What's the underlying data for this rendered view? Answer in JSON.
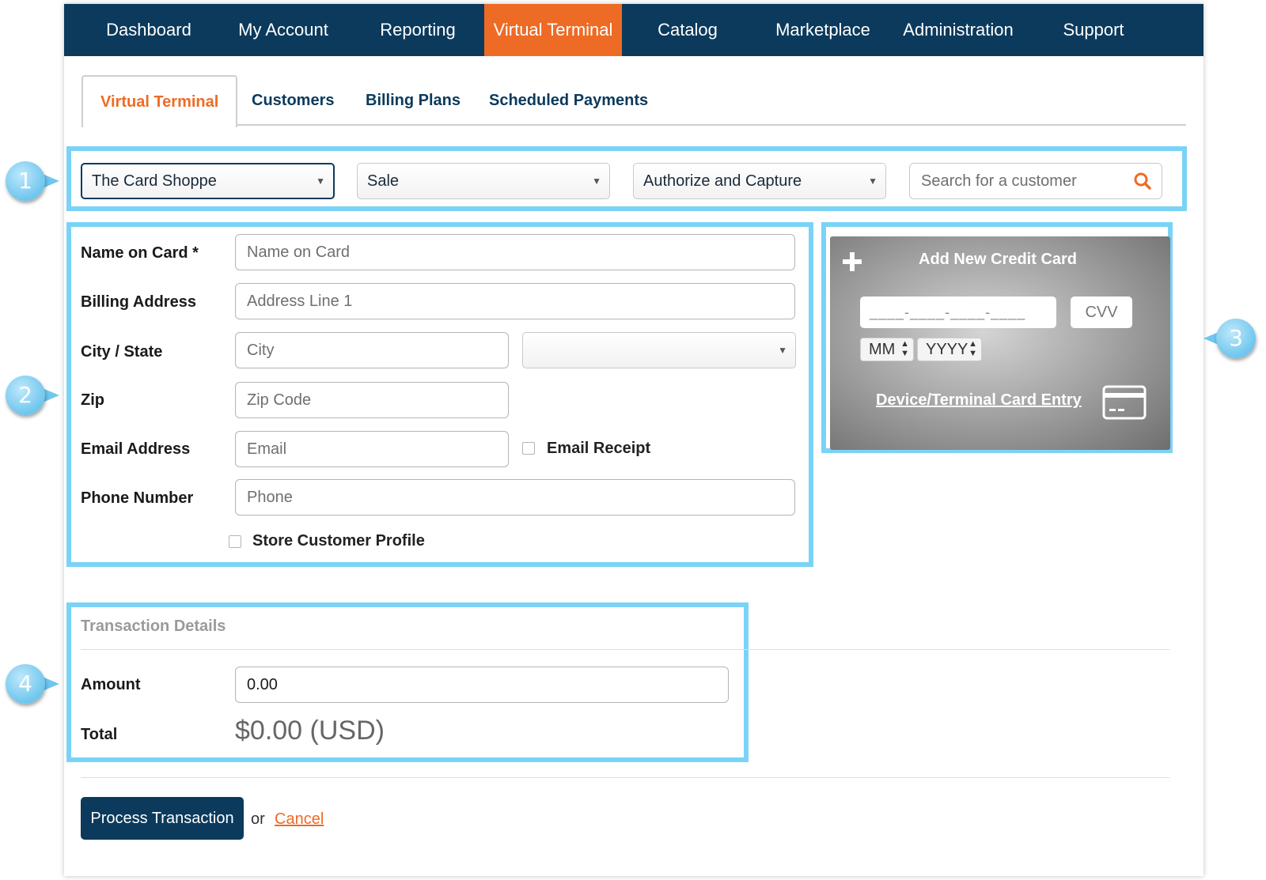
{
  "topnav": {
    "items": [
      {
        "label": "Dashboard"
      },
      {
        "label": "My Account"
      },
      {
        "label": "Reporting"
      },
      {
        "label": "Virtual Terminal",
        "active": true
      },
      {
        "label": "Catalog"
      },
      {
        "label": "Marketplace"
      },
      {
        "label": "Administration"
      },
      {
        "label": "Support"
      }
    ],
    "active_color": "#ee6b25",
    "bg_color": "#0b3a5c"
  },
  "subtabs": [
    {
      "label": "Virtual Terminal",
      "active": true
    },
    {
      "label": "Customers"
    },
    {
      "label": "Billing Plans"
    },
    {
      "label": "Scheduled Payments"
    }
  ],
  "toolbar": {
    "merchant_select": "The Card Shoppe",
    "transaction_type_select": "Sale",
    "action_select": "Authorize and Capture",
    "search_placeholder": "Search for a customer"
  },
  "customer_form": {
    "name_label": "Name on Card *",
    "name_placeholder": "Name on Card",
    "address_label": "Billing Address",
    "address_placeholder": "Address Line 1",
    "city_state_label": "City / State",
    "city_placeholder": "City",
    "state_value": "",
    "zip_label": "Zip",
    "zip_placeholder": "Zip Code",
    "email_label": "Email Address",
    "email_placeholder": "Email",
    "email_receipt_label": "Email Receipt",
    "phone_label": "Phone Number",
    "phone_placeholder": "Phone",
    "store_profile_label": "Store Customer Profile"
  },
  "card_panel": {
    "title": "Add New Credit Card",
    "card_number_mask": "____-____-____-____",
    "cvv_placeholder": "CVV",
    "month_placeholder": "MM",
    "year_placeholder": "YYYY",
    "device_link": "Device/Terminal Card Entry"
  },
  "transaction": {
    "section_title": "Transaction Details",
    "amount_label": "Amount",
    "amount_value": "0.00",
    "total_label": "Total",
    "total_value": "$0.00 (USD)"
  },
  "actions": {
    "process_label": "Process Transaction",
    "or_text": "or",
    "cancel_label": "Cancel"
  },
  "callouts": [
    "1",
    "2",
    "3",
    "4"
  ],
  "highlight_color": "#7ad3f7"
}
